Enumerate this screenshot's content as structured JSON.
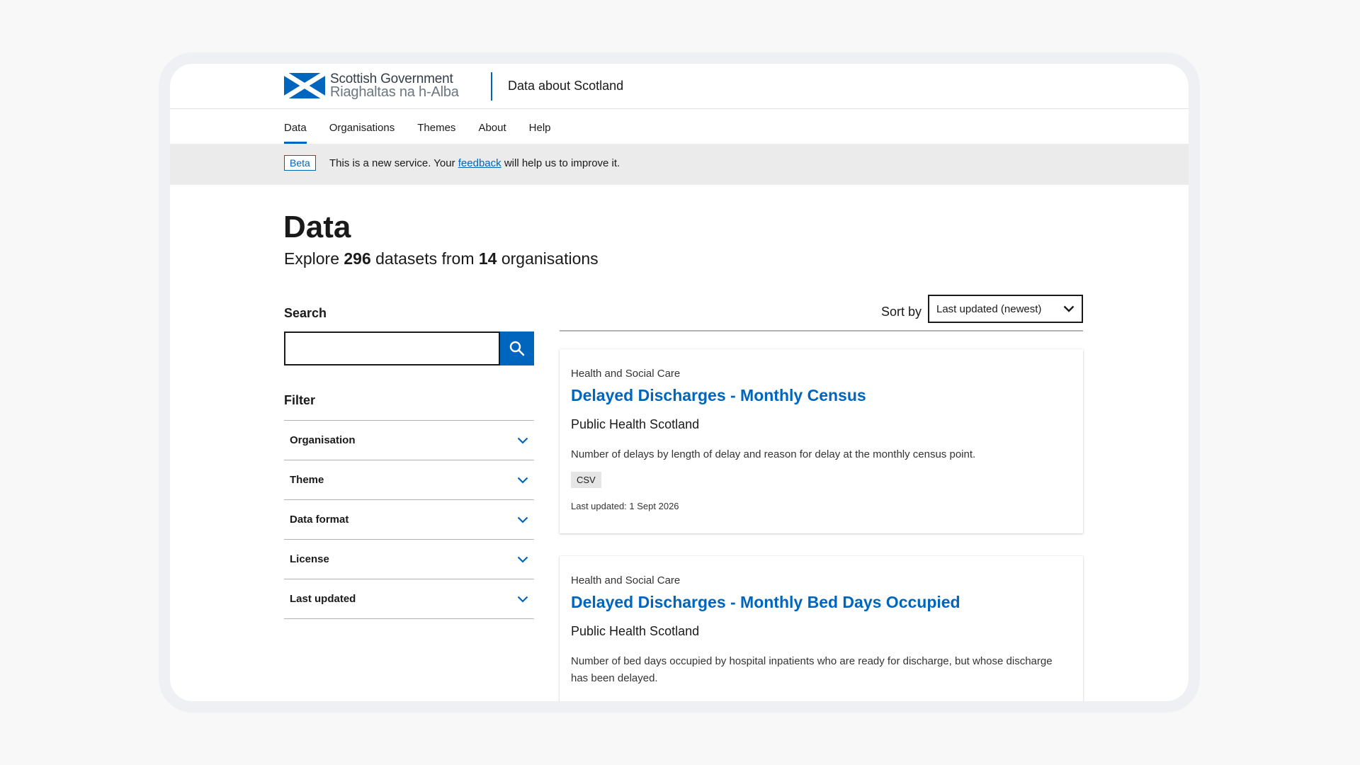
{
  "header": {
    "logo_en": "Scottish Government",
    "logo_gd": "Riaghaltas na h-Alba",
    "site_name": "Data about Scotland"
  },
  "nav": {
    "items": [
      {
        "label": "Data",
        "active": true
      },
      {
        "label": "Organisations"
      },
      {
        "label": "Themes"
      },
      {
        "label": "About"
      },
      {
        "label": "Help"
      }
    ]
  },
  "banner": {
    "tag": "Beta",
    "text_before": "This is a new service. Your ",
    "link": "feedback",
    "text_after": " will help us to improve it."
  },
  "page": {
    "title": "Data",
    "subtitle_prefix": "Explore ",
    "dataset_count": "296",
    "subtitle_middle": " datasets from ",
    "org_count": "14",
    "subtitle_suffix": " organisations"
  },
  "search": {
    "label": "Search",
    "value": "",
    "placeholder": ""
  },
  "filter": {
    "label": "Filter",
    "items": [
      "Organisation",
      "Theme",
      "Data format",
      "License",
      "Last updated"
    ]
  },
  "sort": {
    "label": "Sort by",
    "selected": "Last updated (newest)"
  },
  "results": [
    {
      "theme": "Health and Social Care",
      "title": "Delayed Discharges - Monthly Census",
      "organisation": "Public Health Scotland",
      "description": "Number of delays by length of delay and reason for delay at the monthly census point.",
      "format": "CSV",
      "updated_label": "Last updated:",
      "updated_date": "1 Sept 2026"
    },
    {
      "theme": "Health and Social Care",
      "title": "Delayed Discharges - Monthly Bed Days Occupied",
      "organisation": "Public Health Scotland",
      "description": "Number of bed days occupied by hospital inpatients who are ready for discharge, but whose discharge has been delayed."
    }
  ],
  "colors": {
    "brand_blue": "#0065bd",
    "banner_bg": "#ebebeb",
    "page_bg": "#f8f8f8"
  }
}
